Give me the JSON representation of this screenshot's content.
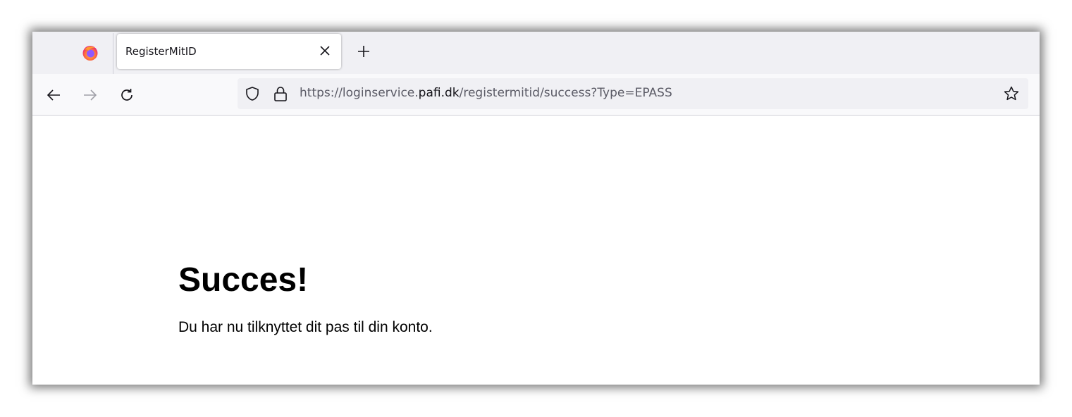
{
  "tab": {
    "title": "RegisterMitID",
    "close_icon": "close-icon",
    "new_tab_icon": "plus-icon"
  },
  "nav": {
    "back_icon": "arrow-left-icon",
    "forward_icon": "arrow-right-icon",
    "reload_icon": "reload-icon"
  },
  "urlbar": {
    "prefix": "https://loginservice.",
    "host": "pafi.dk",
    "path": "/registermitid/success?Type=EPASS",
    "shield_icon": "shield-icon",
    "lock_icon": "lock-icon",
    "bookmark_icon": "star-icon"
  },
  "page": {
    "heading": "Succes!",
    "message": "Du har nu tilknyttet dit pas til din konto."
  },
  "colors": {
    "tabbar_bg": "#f0f0f4",
    "navbar_bg": "#f9f9fb",
    "url_text": "#5b5b66",
    "firefox_orange": "#ff7139",
    "firefox_purple": "#9059ff"
  }
}
